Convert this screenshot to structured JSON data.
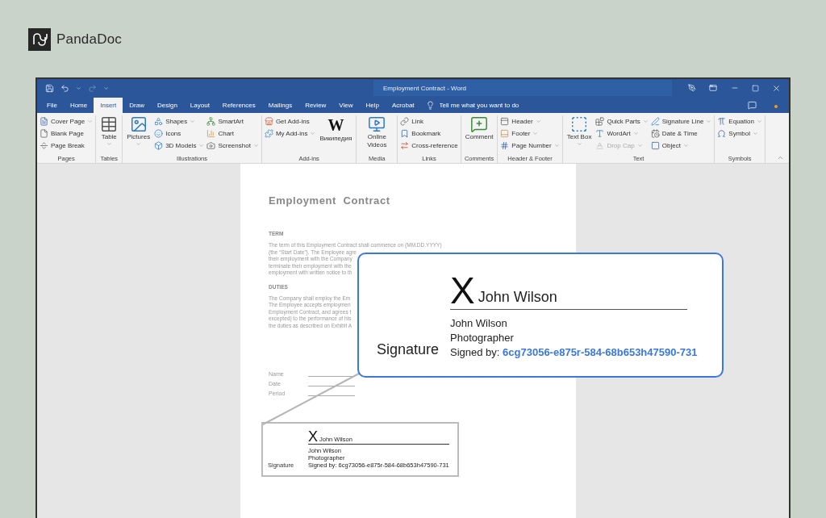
{
  "brand": {
    "name": "PandaDoc"
  },
  "window": {
    "title": "Employment Contract - Word"
  },
  "tabs": [
    {
      "label": "File",
      "selected": false
    },
    {
      "label": "Home",
      "selected": false
    },
    {
      "label": "Insert",
      "selected": true
    },
    {
      "label": "Draw",
      "selected": false
    },
    {
      "label": "Design",
      "selected": false
    },
    {
      "label": "Layout",
      "selected": false
    },
    {
      "label": "References",
      "selected": false
    },
    {
      "label": "Mailings",
      "selected": false
    },
    {
      "label": "Review",
      "selected": false
    },
    {
      "label": "View",
      "selected": false
    },
    {
      "label": "Help",
      "selected": false
    },
    {
      "label": "Acrobat",
      "selected": false
    }
  ],
  "tell_me": {
    "placeholder": "Tell me what you want to do"
  },
  "ribbon": {
    "groups": [
      {
        "label": "Pages",
        "columns": [
          {
            "kind": "stack",
            "items": [
              {
                "label": "Cover Page",
                "dropdown": true,
                "disabled": false
              },
              {
                "label": "Blank Page",
                "dropdown": false,
                "disabled": false
              },
              {
                "label": "Page Break",
                "dropdown": false,
                "disabled": false
              }
            ]
          }
        ]
      },
      {
        "label": "Tables",
        "columns": [
          {
            "kind": "large",
            "items": [
              {
                "label": "Table",
                "dropdown": true,
                "disabled": false
              }
            ]
          }
        ]
      },
      {
        "label": "Illustrations",
        "columns": [
          {
            "kind": "large",
            "items": [
              {
                "label": "Pictures",
                "dropdown": true,
                "disabled": false
              }
            ]
          },
          {
            "kind": "stack",
            "items": [
              {
                "label": "Shapes",
                "dropdown": true,
                "disabled": false
              },
              {
                "label": "Icons",
                "dropdown": false,
                "disabled": false
              },
              {
                "label": "3D Models",
                "dropdown": true,
                "disabled": false
              }
            ]
          },
          {
            "kind": "stack",
            "items": [
              {
                "label": "SmartArt",
                "dropdown": false,
                "disabled": false
              },
              {
                "label": "Chart",
                "dropdown": false,
                "disabled": false
              },
              {
                "label": "Screenshot",
                "dropdown": true,
                "disabled": false
              }
            ]
          }
        ]
      },
      {
        "label": "Add-ins",
        "columns": [
          {
            "kind": "stack",
            "items": [
              {
                "label": "Get Add-ins",
                "dropdown": false,
                "disabled": false
              },
              {
                "label": "My Add-ins",
                "dropdown": true,
                "disabled": false
              }
            ]
          },
          {
            "kind": "large",
            "items": [
              {
                "label": "Википедия",
                "glyph": "W",
                "dropdown": false,
                "disabled": false
              }
            ]
          }
        ]
      },
      {
        "label": "Media",
        "columns": [
          {
            "kind": "large",
            "items": [
              {
                "label": "Online Videos",
                "dropdown": false,
                "disabled": false
              }
            ]
          }
        ]
      },
      {
        "label": "Links",
        "columns": [
          {
            "kind": "stack",
            "items": [
              {
                "label": "Link",
                "dropdown": false,
                "disabled": false
              },
              {
                "label": "Bookmark",
                "dropdown": false,
                "disabled": false
              },
              {
                "label": "Cross-reference",
                "dropdown": false,
                "disabled": false
              }
            ]
          }
        ]
      },
      {
        "label": "Comments",
        "columns": [
          {
            "kind": "large",
            "items": [
              {
                "label": "Comment",
                "dropdown": false,
                "disabled": false
              }
            ]
          }
        ]
      },
      {
        "label": "Header & Footer",
        "columns": [
          {
            "kind": "stack",
            "items": [
              {
                "label": "Header",
                "dropdown": true,
                "disabled": false
              },
              {
                "label": "Footer",
                "dropdown": true,
                "disabled": false
              },
              {
                "label": "Page Number",
                "dropdown": true,
                "disabled": false
              }
            ]
          }
        ]
      },
      {
        "label": "Text",
        "columns": [
          {
            "kind": "large",
            "items": [
              {
                "label": "Text Box",
                "dropdown": true,
                "disabled": false
              }
            ]
          },
          {
            "kind": "stack",
            "items": [
              {
                "label": "Quick Parts",
                "dropdown": true,
                "disabled": false
              },
              {
                "label": "WordArt",
                "dropdown": true,
                "disabled": false
              },
              {
                "label": "Drop Cap",
                "dropdown": true,
                "disabled": true
              }
            ]
          },
          {
            "kind": "stack",
            "items": [
              {
                "label": "Signature Line",
                "dropdown": true,
                "disabled": false
              },
              {
                "label": "Date & Time",
                "dropdown": false,
                "disabled": false
              },
              {
                "label": "Object",
                "dropdown": true,
                "disabled": false
              }
            ]
          }
        ]
      },
      {
        "label": "Symbols",
        "columns": [
          {
            "kind": "stack",
            "items": [
              {
                "label": "Equation",
                "dropdown": true,
                "disabled": false
              },
              {
                "label": "Symbol",
                "dropdown": true,
                "disabled": false
              }
            ]
          }
        ]
      }
    ]
  },
  "document": {
    "title": "Employment  Contract",
    "sections": [
      {
        "heading": "TERM",
        "lines": [
          "The term of this Employment Contract shall commence on (MM.DD.YYYY)",
          "(the “Start Date”). The Employee agre",
          "their employment with the Company",
          "terminate their employment with the",
          "employment with written notice to th"
        ]
      },
      {
        "heading": "DUTIES",
        "lines": [
          "The Company shall employ the Em",
          "The Employee accepts employmen",
          "Employment Contract, and agrees t",
          "excepted) to the performance of his",
          "the duties as described on Exhibit A"
        ]
      }
    ],
    "fields": [
      {
        "label": "Name"
      },
      {
        "label": "Date"
      },
      {
        "label": "Period"
      }
    ],
    "signature_thumbnail": {
      "mark": "X",
      "name": "John Wilson",
      "signer_name": "John Wilson",
      "role": "Photographer",
      "label": "Signature",
      "signed_by_label": "Signed by:",
      "signed_by_id": "6cg73056-e875r-584-68b653h47590-731"
    }
  },
  "signature_callout": {
    "mark": "X",
    "name": "John Wilson",
    "signer_name": "John Wilson",
    "role": "Photographer",
    "label": "Signature",
    "signed_by_label": "Signed by:",
    "signed_by_id": "6cg73056-e875r-584-68b653h47590-731"
  }
}
